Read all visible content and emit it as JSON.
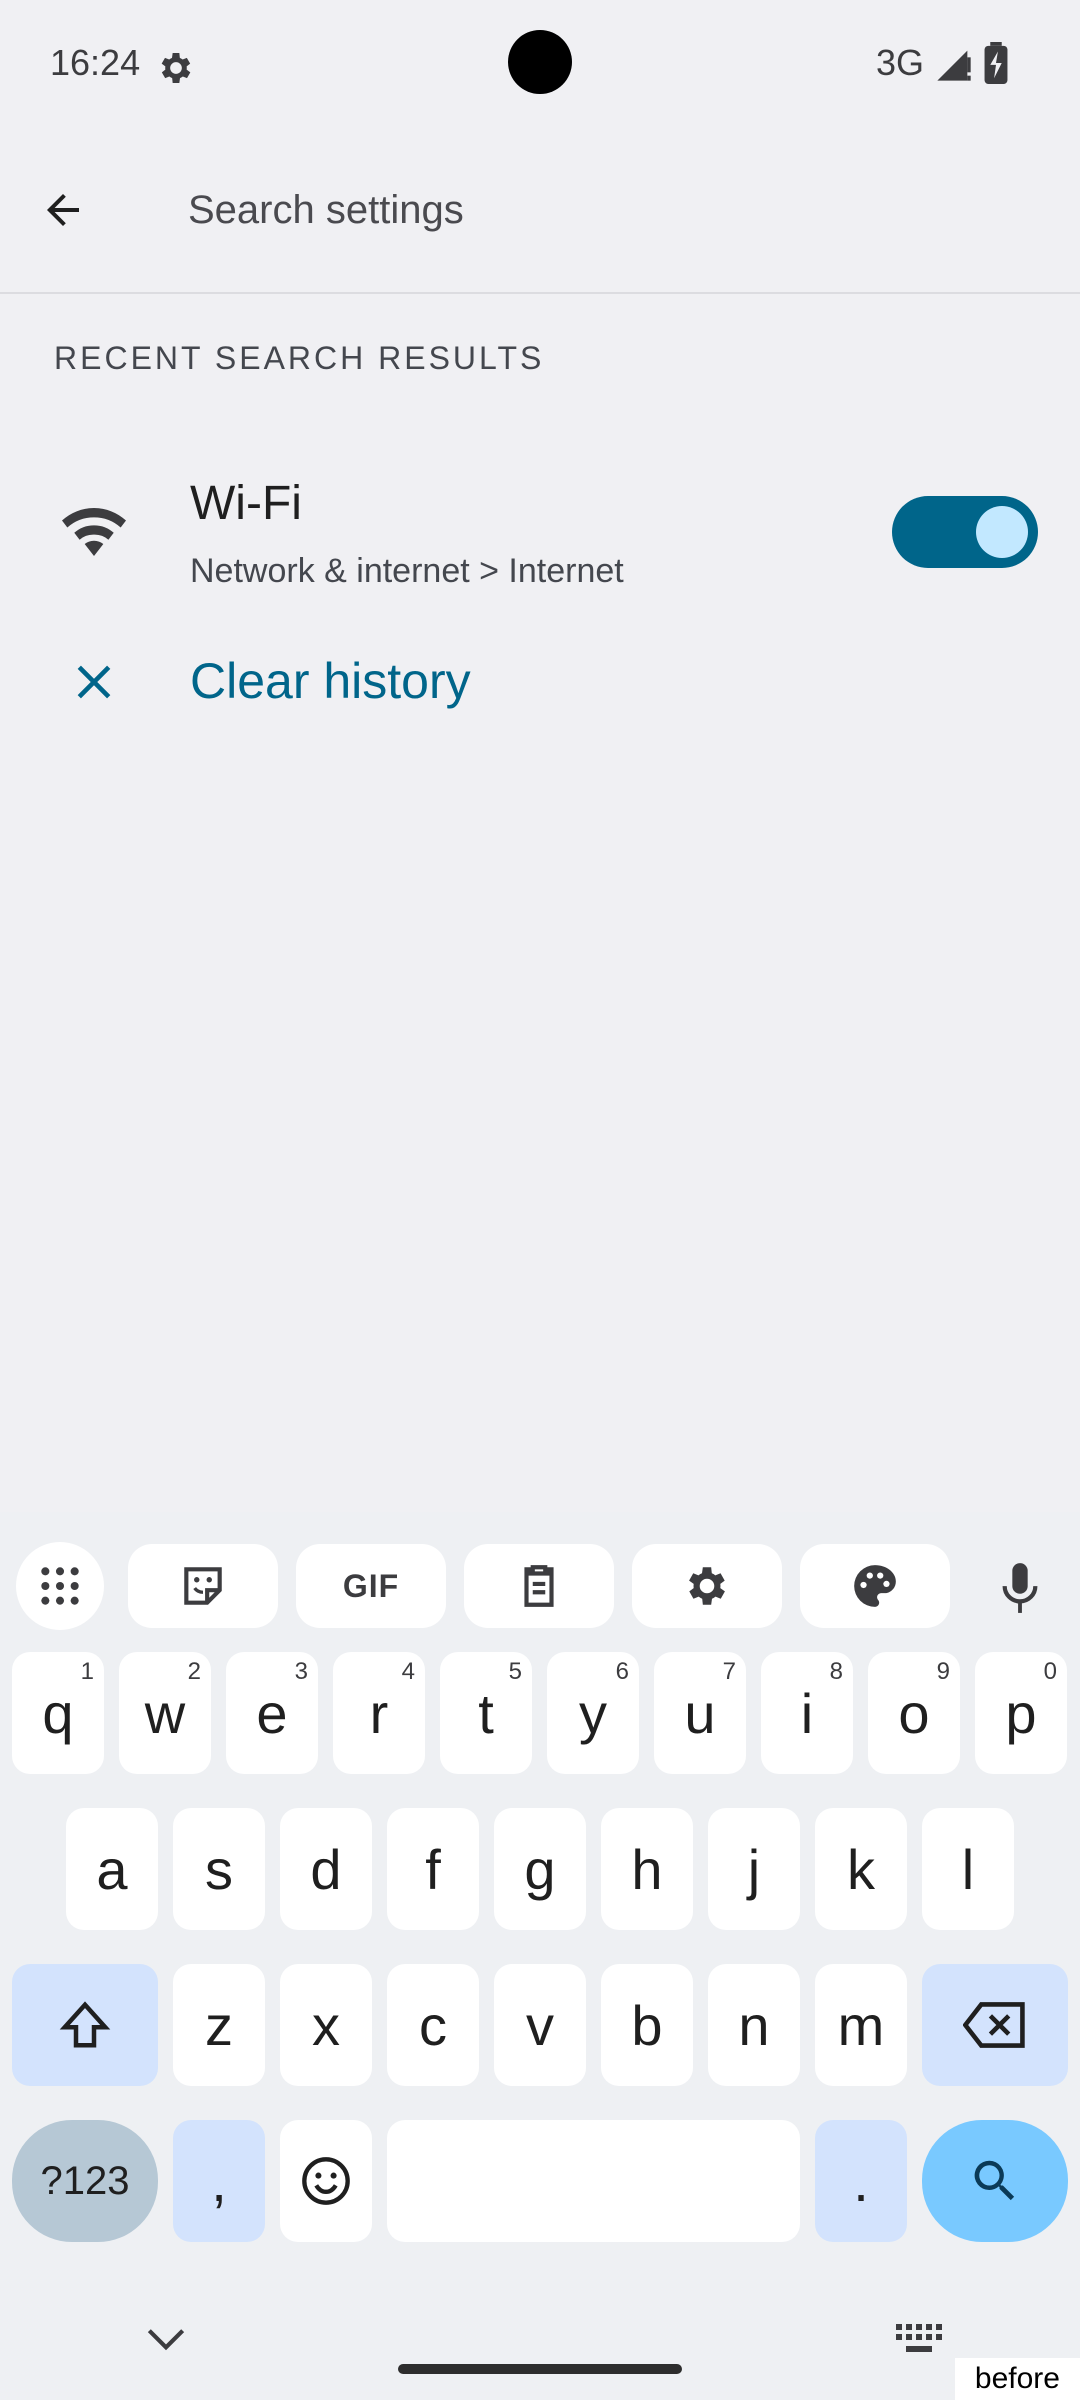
{
  "status_bar": {
    "time": "16:24",
    "network": "3G",
    "icons": [
      "gear-icon",
      "signal-icon",
      "battery-icon"
    ]
  },
  "search": {
    "placeholder": "Search settings",
    "value": ""
  },
  "recent": {
    "header": "RECENT SEARCH RESULTS",
    "items": [
      {
        "icon": "wifi-icon",
        "title": "Wi-Fi",
        "subtitle": "Network & internet > Internet",
        "toggle_on": true
      }
    ],
    "clear_label": "Clear history"
  },
  "keyboard": {
    "toolbar": [
      "apps-grid-icon",
      "sticker-icon",
      "GIF",
      "clipboard-icon",
      "settings-icon",
      "palette-icon",
      "mic-icon"
    ],
    "row1": [
      {
        "k": "q",
        "h": "1"
      },
      {
        "k": "w",
        "h": "2"
      },
      {
        "k": "e",
        "h": "3"
      },
      {
        "k": "r",
        "h": "4"
      },
      {
        "k": "t",
        "h": "5"
      },
      {
        "k": "y",
        "h": "6"
      },
      {
        "k": "u",
        "h": "7"
      },
      {
        "k": "i",
        "h": "8"
      },
      {
        "k": "o",
        "h": "9"
      },
      {
        "k": "p",
        "h": "0"
      }
    ],
    "row2": [
      "a",
      "s",
      "d",
      "f",
      "g",
      "h",
      "j",
      "k",
      "l"
    ],
    "row3": [
      "z",
      "x",
      "c",
      "v",
      "b",
      "n",
      "m"
    ],
    "row4": {
      "symbols": "?123",
      "comma": ",",
      "period": "."
    }
  },
  "footer_label": "before",
  "colors": {
    "accent": "#00658a",
    "toggle_knob": "#c2e8ff",
    "background": "#f0f0f3",
    "enter_key": "#79c9ff"
  }
}
